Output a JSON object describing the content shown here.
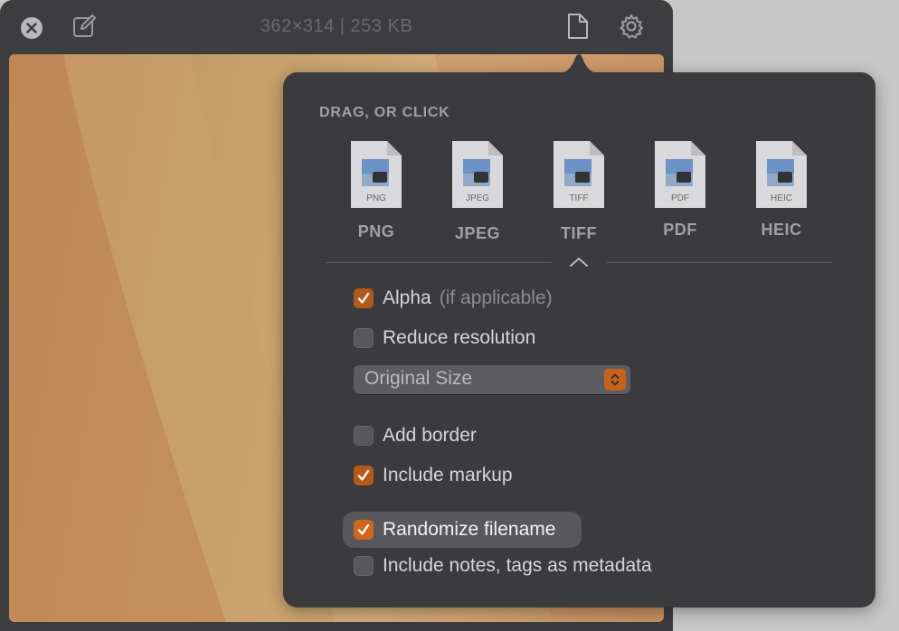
{
  "window": {
    "title": "362×314 | 253 KB"
  },
  "popover": {
    "section_label": "DRAG, OR CLICK",
    "formats": [
      {
        "label": "PNG",
        "badge": "PNG"
      },
      {
        "label": "JPEG",
        "badge": "JPEG"
      },
      {
        "label": "TIFF",
        "badge": "TIFF"
      },
      {
        "label": "PDF",
        "badge": "PDF"
      },
      {
        "label": "HEIC",
        "badge": "HEIC"
      }
    ],
    "options": {
      "alpha": {
        "label": "Alpha",
        "sub": "(if applicable)",
        "checked": true
      },
      "reduce_resolution": {
        "label": "Reduce resolution",
        "checked": false
      },
      "size_select": {
        "value": "Original Size"
      },
      "add_border": {
        "label": "Add border",
        "checked": false
      },
      "include_markup": {
        "label": "Include markup",
        "checked": true
      },
      "randomize_filename": {
        "label": "Randomize filename",
        "checked": true
      },
      "include_notes": {
        "label": "Include notes, tags as metadata",
        "checked": false
      }
    }
  },
  "colors": {
    "accent": "#d0661b",
    "window_bg": "#3d3d40",
    "popover_bg": "#3b3b3e",
    "desktop_bg": "#c7c7c7"
  },
  "icons": {
    "close": "close-icon",
    "edit": "edit-icon",
    "file": "document-icon",
    "settings": "gear-icon",
    "collapse": "chevron-up-icon"
  }
}
